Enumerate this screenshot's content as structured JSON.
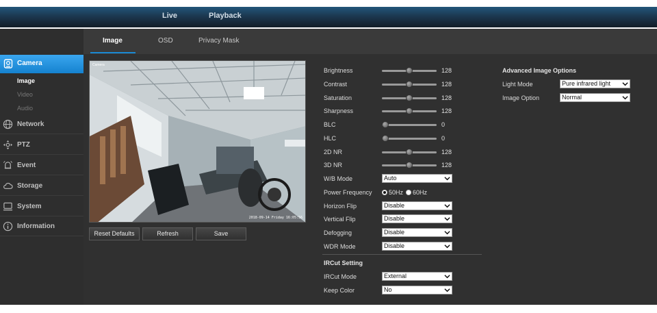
{
  "topnav": {
    "live": "Live",
    "playback": "Playback"
  },
  "tabs": [
    "Image",
    "OSD",
    "Privacy Mask"
  ],
  "sidebar": {
    "camera": {
      "label": "Camera",
      "icon": "camera-icon",
      "sub": [
        "Image",
        "Video",
        "Audio"
      ]
    },
    "groups": [
      {
        "label": "Network",
        "icon": "globe-icon"
      },
      {
        "label": "PTZ",
        "icon": "ptz-icon"
      },
      {
        "label": "Event",
        "icon": "bell-icon"
      },
      {
        "label": "Storage",
        "icon": "cloud-icon"
      },
      {
        "label": "System",
        "icon": "monitor-icon"
      },
      {
        "label": "Information",
        "icon": "info-icon"
      }
    ]
  },
  "preview": {
    "camera_label": "Camera",
    "timestamp": "2018-09-14 Friday 16:05:56"
  },
  "buttons": {
    "reset": "Reset Defaults",
    "refresh": "Refresh",
    "save": "Save"
  },
  "sliders": [
    {
      "label": "Brightness",
      "value": 128,
      "max": 255
    },
    {
      "label": "Contrast",
      "value": 128,
      "max": 255
    },
    {
      "label": "Saturation",
      "value": 128,
      "max": 255
    },
    {
      "label": "Sharpness",
      "value": 128,
      "max": 255
    },
    {
      "label": "BLC",
      "value": 0,
      "max": 255
    },
    {
      "label": "HLC",
      "value": 0,
      "max": 255
    },
    {
      "label": "2D NR",
      "value": 128,
      "max": 255
    },
    {
      "label": "3D NR",
      "value": 128,
      "max": 255
    }
  ],
  "wb_mode": {
    "label": "W/B Mode",
    "value": "Auto"
  },
  "power_frequency": {
    "label": "Power Frequency",
    "options": [
      "50Hz",
      "60Hz"
    ],
    "selected": "50Hz"
  },
  "dropdowns": [
    {
      "label": "Horizon Flip",
      "value": "Disable"
    },
    {
      "label": "Vertical Flip",
      "value": "Disable"
    },
    {
      "label": "Defogging",
      "value": "Disable"
    },
    {
      "label": "WDR Mode",
      "value": "Disable"
    }
  ],
  "ircut": {
    "title": "IRCut Setting",
    "mode": {
      "label": "IRCut Mode",
      "value": "External"
    },
    "keep_color": {
      "label": "Keep Color",
      "value": "No"
    }
  },
  "advanced": {
    "title": "Advanced Image Options",
    "light_mode": {
      "label": "Light Mode",
      "value": "Pure infrared light"
    },
    "image_option": {
      "label": "Image Option",
      "value": "Normal"
    }
  },
  "colors": {
    "accent": "#1a8ad4",
    "panel": "#303030",
    "sidebar_active": "#2a96e0"
  }
}
